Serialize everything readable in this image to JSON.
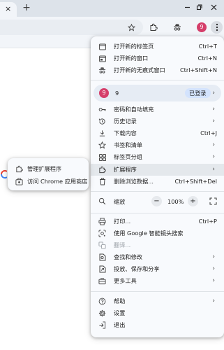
{
  "browser": {
    "tab_close_glyph": "×",
    "new_tab_glyph": "+",
    "profile_initial": "9"
  },
  "menu": {
    "items_top": [
      {
        "label": "打开新的标签页",
        "shortcut": "Ctrl+T",
        "icon": "new-tab-icon"
      },
      {
        "label": "打开新的窗口",
        "shortcut": "Ctrl+N",
        "icon": "new-window-icon"
      },
      {
        "label": "打开新的无痕式窗口",
        "shortcut": "Ctrl+Shift+N",
        "icon": "incognito-icon"
      }
    ],
    "profile": {
      "avatar": "9",
      "name": "9",
      "badge": "已登录"
    },
    "items_mid": [
      {
        "label": "密码和自动填充",
        "icon": "key-icon"
      },
      {
        "label": "历史记录",
        "icon": "history-icon"
      },
      {
        "label": "下载内容",
        "shortcut": "Ctrl+J",
        "icon": "download-icon"
      },
      {
        "label": "书签和清单",
        "icon": "star-icon"
      },
      {
        "label": "标签页分组",
        "icon": "tab-groups-icon"
      },
      {
        "label": "扩展程序",
        "icon": "puzzle-icon"
      },
      {
        "label": "删除浏览数据...",
        "shortcut": "Ctrl+Shift+Del",
        "icon": "trash-icon"
      }
    ],
    "zoom": {
      "label": "缩放",
      "minus": "−",
      "value": "100%",
      "plus": "+"
    },
    "items_tools": [
      {
        "label": "打印...",
        "shortcut": "Ctrl+P",
        "icon": "print-icon"
      },
      {
        "label": "使用 Google 智能镜头搜索",
        "icon": "lens-icon"
      },
      {
        "label": "翻译...",
        "icon": "translate-icon"
      },
      {
        "label": "查找和修改",
        "icon": "find-icon"
      },
      {
        "label": "投放、保存和分享",
        "icon": "cast-icon"
      },
      {
        "label": "更多工具",
        "icon": "toolbox-icon"
      }
    ],
    "items_bottom": [
      {
        "label": "帮助",
        "icon": "help-icon"
      },
      {
        "label": "设置",
        "icon": "gear-icon"
      },
      {
        "label": "退出",
        "icon": "exit-icon"
      }
    ],
    "arrow_glyph": "›"
  },
  "extensions_submenu": {
    "items": [
      {
        "label": "管理扩展程序",
        "icon": "puzzle-icon"
      },
      {
        "label": "访问 Chrome 应用商店",
        "icon": "store-icon"
      }
    ]
  },
  "colors": {
    "accent_avatar": "#d53e6a",
    "badge_bg": "#d3e3fd",
    "highlight_row": "#e4e8ec"
  }
}
